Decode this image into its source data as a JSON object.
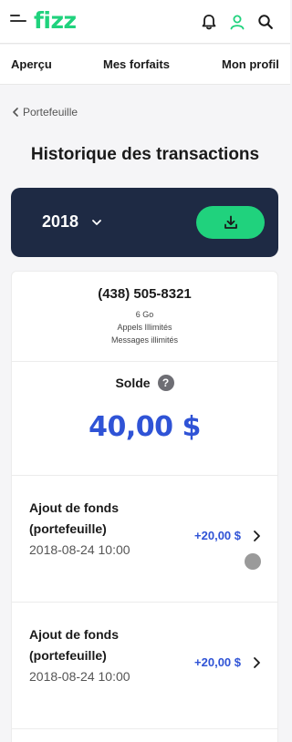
{
  "header": {
    "logo": "fizz",
    "icons": [
      "menu-icon",
      "bell-icon",
      "user-icon",
      "search-icon"
    ],
    "colors": {
      "brand": "#20d27d",
      "navy": "#1e2a44",
      "accent_blue": "#2f53d6"
    }
  },
  "nav": {
    "items": [
      {
        "label": "Aperçu"
      },
      {
        "label": "Mes forfaits"
      },
      {
        "label": "Mon profil"
      }
    ]
  },
  "breadcrumb": {
    "label": "Portefeuille"
  },
  "page_title": "Historique des transactions",
  "year_filter": {
    "selected": "2018"
  },
  "account": {
    "phone": "(438) 505-8321",
    "plan_lines": [
      "6 Go",
      "Appels Illimités",
      "Messages illimités"
    ],
    "balance_label": "Solde",
    "balance_help": "?",
    "balance": "40,00 $"
  },
  "transactions": [
    {
      "title": "Ajout de fonds (portefeuille)",
      "date": "2018-08-24 10:00",
      "amount": "+20,00 $"
    },
    {
      "title": "Ajout de fonds (portefeuille)",
      "date": "2018-08-24 10:00",
      "amount": "+20,00 $"
    }
  ]
}
